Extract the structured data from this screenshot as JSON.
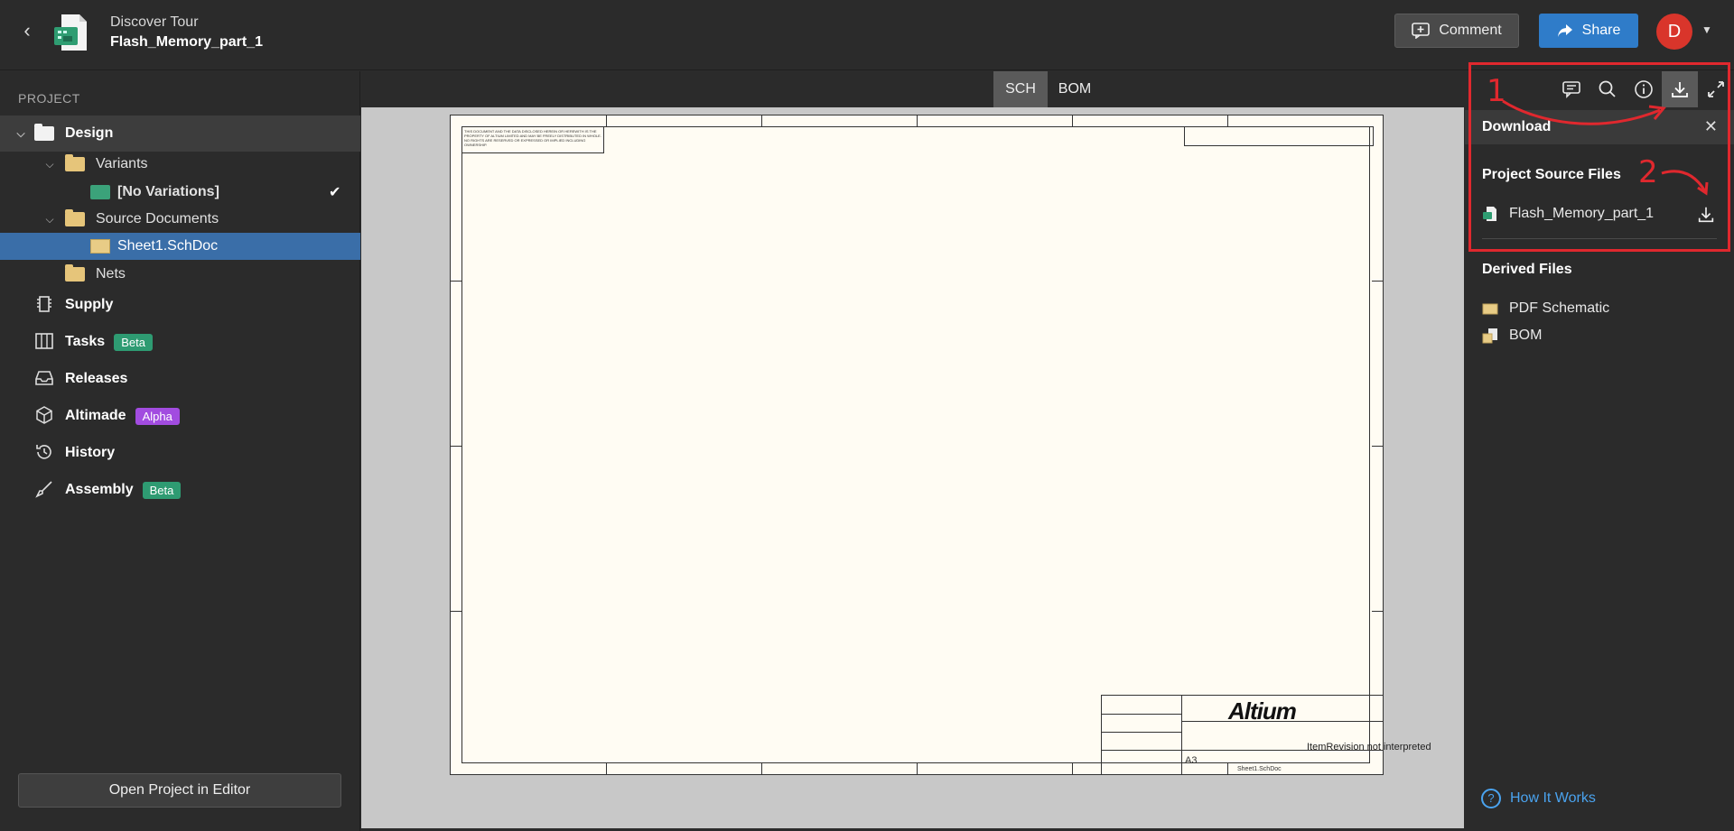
{
  "header": {
    "back_icon": "chevron-left-icon",
    "subtitle": "Discover Tour",
    "title": "Flash_Memory_part_1",
    "comment_label": "Comment",
    "share_label": "Share",
    "avatar_initial": "D"
  },
  "sidebar": {
    "heading": "PROJECT",
    "design_label": "Design",
    "variants_label": "Variants",
    "no_variations_label": "[No Variations]",
    "source_docs_label": "Source Documents",
    "sheet_label": "Sheet1.SchDoc",
    "nets_label": "Nets",
    "nav": [
      {
        "label": "Supply",
        "badge": ""
      },
      {
        "label": "Tasks",
        "badge": "Beta"
      },
      {
        "label": "Releases",
        "badge": ""
      },
      {
        "label": "Altimade",
        "badge": "Alpha"
      },
      {
        "label": "History",
        "badge": ""
      },
      {
        "label": "Assembly",
        "badge": "Beta"
      }
    ],
    "open_button_label": "Open Project in Editor"
  },
  "viewer": {
    "tabs": [
      "SCH",
      "BOM"
    ],
    "active_tab": "SCH",
    "sheet_note": "THIS DOCUMENT AND THE DATA DISCLOSED HEREIN OR HEREWITH IS THE PROPERTY OF ALTIUM LIMITED AND MAY BE FREELY DISTRIBUTED IN WHOLE. NO RIGHTS ARE RESERVED OR EXPRESSED OR IMPLIED INCLUDING OWNERSHIP.",
    "logo_text": "Altium",
    "size_label": "A3",
    "filename": "Sheet1.SchDoc",
    "item_revision_text": "ItemRevision not interpreted"
  },
  "right_panel": {
    "toolbar": [
      "comments-icon",
      "search-icon",
      "info-icon",
      "download-icon",
      "expand-icon"
    ],
    "download_title": "Download",
    "project_source_title": "Project Source Files",
    "source_file": "Flash_Memory_part_1",
    "derived_title": "Derived Files",
    "derived_files": [
      "PDF Schematic",
      "BOM"
    ],
    "how_it_works": "How It Works"
  },
  "annotations": {
    "step1": "1",
    "step2": "2",
    "color": "#e0282e"
  }
}
